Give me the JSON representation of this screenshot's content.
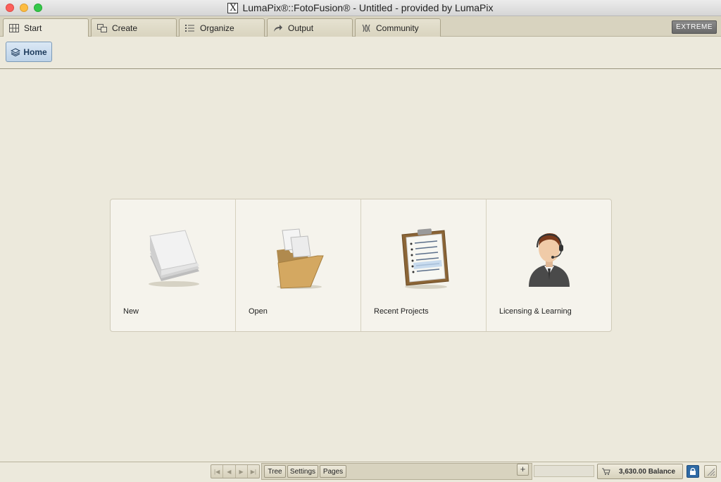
{
  "window": {
    "title": "LumaPix®::FotoFusion® - Untitled - provided by LumaPix"
  },
  "tabs": [
    {
      "label": "Start",
      "icon": "grid-icon",
      "active": true
    },
    {
      "label": "Create",
      "icon": "create-icon",
      "active": false
    },
    {
      "label": "Organize",
      "icon": "list-icon",
      "active": false
    },
    {
      "label": "Output",
      "icon": "share-arrow-icon",
      "active": false
    },
    {
      "label": "Community",
      "icon": "community-icon",
      "active": false
    }
  ],
  "edition_badge": "EXTREME",
  "toolbar": {
    "home_label": "Home"
  },
  "start_panel": {
    "items": [
      {
        "label": "New",
        "icon": "blank-paper-stack-icon"
      },
      {
        "label": "Open",
        "icon": "open-folder-icon"
      },
      {
        "label": "Recent Projects",
        "icon": "clipboard-icon"
      },
      {
        "label": "Licensing & Learning",
        "icon": "support-agent-icon"
      }
    ]
  },
  "statusbar": {
    "view_tabs": [
      "Tree",
      "Settings",
      "Pages"
    ],
    "plus_label": "+",
    "balance_label": "3,630.00 Balance"
  },
  "colors": {
    "background": "#ece9dc",
    "panel": "#f5f3ec",
    "home_button": "#bcd2e8",
    "lock_button": "#2f6aa5"
  }
}
